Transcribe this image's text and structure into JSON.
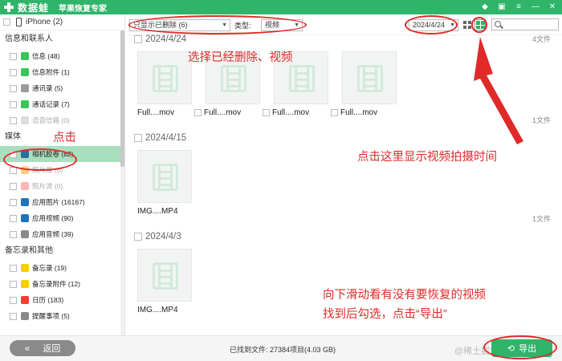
{
  "titlebar": {
    "brand": "数据蛙",
    "app_name": "苹果恢复专家",
    "icons": [
      "diamond-icon",
      "gift-icon",
      "menu-icon",
      "minimize-icon",
      "close-icon"
    ]
  },
  "sidebar": {
    "device": "iPhone (2)",
    "sections": [
      {
        "title": "信息和联系人",
        "items": [
          {
            "label": "信息 (48)",
            "icon": "message-icon",
            "color": "#34c759"
          },
          {
            "label": "信息附件 (1)",
            "icon": "attachment-icon",
            "color": "#34c759"
          },
          {
            "label": "通讯录 (5)",
            "icon": "contacts-icon",
            "color": "#9a9a9a"
          },
          {
            "label": "通话记录 (7)",
            "icon": "phone-icon",
            "color": "#34c759"
          },
          {
            "label": "语音信箱 (0)",
            "icon": "voicemail-icon",
            "color": "#bbbbbb",
            "dim": true
          }
        ]
      },
      {
        "title": "媒体",
        "items": [
          {
            "label": "相机胶卷 (82)",
            "icon": "camera-roll-icon",
            "color": "#2a6f9e",
            "selected": true
          },
          {
            "label": "照片库 (0)",
            "icon": "photo-library-icon",
            "color": "#ff9f0a",
            "dim": true
          },
          {
            "label": "照片流 (0)",
            "icon": "photo-stream-icon",
            "color": "#ff6b6b",
            "dim": true
          },
          {
            "label": "应用图片 (16167)",
            "icon": "app-photos-icon",
            "color": "#1e73be"
          },
          {
            "label": "应用视频 (90)",
            "icon": "app-videos-icon",
            "color": "#1e73be"
          },
          {
            "label": "应用音频 (39)",
            "icon": "app-audio-icon",
            "color": "#8a8a8a"
          }
        ]
      },
      {
        "title": "备忘录和其他",
        "items": [
          {
            "label": "备忘录 (19)",
            "icon": "notes-icon",
            "color": "#ffcc00"
          },
          {
            "label": "备忘录附件 (12)",
            "icon": "notes-attachment-icon",
            "color": "#ffcc00"
          },
          {
            "label": "日历 (183)",
            "icon": "calendar-icon",
            "color": "#ff3b30"
          },
          {
            "label": "提醒事项 (5)",
            "icon": "reminders-icon",
            "color": "#8a8a8a"
          }
        ]
      }
    ]
  },
  "filters": {
    "show_filter": "只显示已删除 (6)",
    "type_label": "类型:",
    "type_value": "视频",
    "date_value": "2024/4/24"
  },
  "groups": [
    {
      "date": "2024/4/24",
      "count": "4文件",
      "files": [
        "Full....mov",
        "Full....mov",
        "Full....mov",
        "Full....mov"
      ]
    },
    {
      "date": "2024/4/15",
      "count": "1文件",
      "files": [
        "IMG....MP4"
      ]
    },
    {
      "date": "2024/4/3",
      "count": "1文件",
      "files": [
        "IMG....MP4"
      ]
    }
  ],
  "bottom": {
    "back_label": "返回",
    "found_status": "已找到文件: 27384项目(4.03 GB)",
    "export_label": "导出",
    "watermark": "@稀土掘金技术社区"
  },
  "annotations": {
    "select_filter": "选择已经删除、视频",
    "click": "点击",
    "click_here_time": "点击这里显示视频拍摄时间",
    "scroll_hint_1": "向下滑动看有没有要恢复的视频",
    "scroll_hint_2": "找到后勾选，点击“导出”",
    "color": "#e02a2a"
  },
  "colors": {
    "brand_green": "#2fb46a",
    "selected_bg": "#a9dfbe"
  }
}
